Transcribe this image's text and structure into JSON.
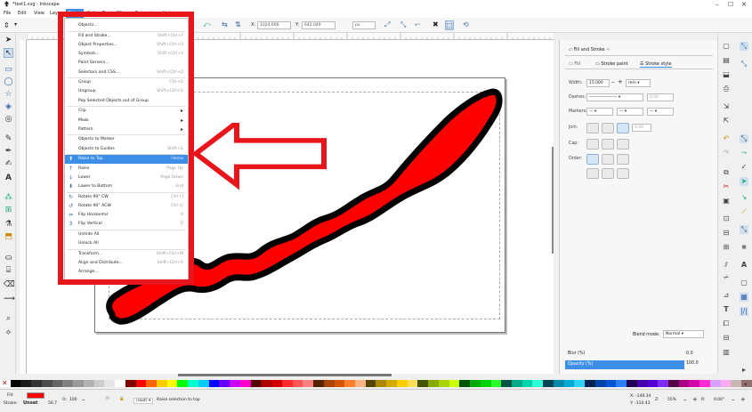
{
  "window": {
    "title": "*test1.svg - Inkscape",
    "controls": [
      "–",
      "☐",
      "✕"
    ]
  },
  "menubar": {
    "items": [
      "File",
      "Edit",
      "View",
      "Layer",
      "Object",
      "Path",
      "Text",
      "Filters",
      "Extensions",
      "Help"
    ],
    "active": "Object"
  },
  "ctrlbar": {
    "x_label": "X:",
    "x_value": "1024.606",
    "y_label": "Y:",
    "y_value": "642.049",
    "unit": "px"
  },
  "object_menu": {
    "items": [
      {
        "label": "Objects...",
        "shortcut": ""
      },
      {
        "label": "Fill and Stroke...",
        "shortcut": "Shift+Ctrl+F"
      },
      {
        "label": "Object Properties...",
        "shortcut": "Shift+Ctrl+O"
      },
      {
        "label": "Symbols...",
        "shortcut": "Shift+Ctrl+Y"
      },
      {
        "label": "Paint Servers...",
        "shortcut": ""
      },
      {
        "label": "Selectors and CSS...",
        "shortcut": "Shift+Ctrl+Q"
      },
      {
        "label": "Group",
        "shortcut": "Ctrl+G"
      },
      {
        "label": "Ungroup",
        "shortcut": "Shift+Ctrl+G"
      },
      {
        "label": "Pop Selected Objects out of Group",
        "shortcut": ""
      },
      {
        "label": "Clip",
        "shortcut": "",
        "submenu": true
      },
      {
        "label": "Mask",
        "shortcut": "",
        "submenu": true
      },
      {
        "label": "Pattern",
        "shortcut": "",
        "submenu": true
      },
      {
        "label": "Objects to Marker",
        "shortcut": ""
      },
      {
        "label": "Objects to Guides",
        "shortcut": "Shift+G"
      },
      {
        "label": "Raise to Top",
        "shortcut": "Home",
        "highlighted": true
      },
      {
        "label": "Raise",
        "shortcut": "Page Up"
      },
      {
        "label": "Lower",
        "shortcut": "Page Down"
      },
      {
        "label": "Lower to Bottom",
        "shortcut": "End"
      },
      {
        "label": "Rotate 90° CW",
        "shortcut": "Ctrl+]"
      },
      {
        "label": "Rotate 90° ACW",
        "shortcut": "Ctrl+["
      },
      {
        "label": "Flip Horizontal",
        "shortcut": "H"
      },
      {
        "label": "Flip Vertical",
        "shortcut": "V"
      },
      {
        "label": "Unhide All",
        "shortcut": ""
      },
      {
        "label": "Unlock All",
        "shortcut": ""
      },
      {
        "label": "Transform...",
        "shortcut": "Shift+Ctrl+M"
      },
      {
        "label": "Align and Distribute...",
        "shortcut": "Shift+Ctrl+A"
      },
      {
        "label": "Arrange...",
        "shortcut": ""
      }
    ]
  },
  "dock": {
    "panel_title": "Fill and Stroke",
    "tabs": [
      "Fill",
      "Stroke paint",
      "Stroke style"
    ],
    "width_label": "Width:",
    "width_value": "15.000",
    "width_unit": "mm",
    "dashes_label": "Dashes:",
    "dashes_value": "0.00",
    "markers_label": "Markers:",
    "join_label": "Join:",
    "join_value": "4.00",
    "cap_label": "Cap:",
    "order_label": "Order:",
    "blend_label": "Blend mode:",
    "blend_value": "Normal",
    "blur_label": "Blur (%)",
    "blur_value": "0.0",
    "opacity_label": "Opacity (%)",
    "opacity_value": "100.0"
  },
  "statusbar": {
    "fill_label": "Fill:",
    "stroke_label": "Stroke:",
    "stroke_state": "Unset",
    "stroke_width": "56.7",
    "opacity_label": "O:",
    "opacity_value": "100",
    "layer": "(root)",
    "message": "Raise selection to top",
    "x_coord": "X: -149.34",
    "y_coord": "Y: -110.43",
    "zoom_label": "Z:",
    "zoom": "55%",
    "rotation_label": "R:",
    "rotation": "0.00°"
  },
  "colors": {
    "shape_fill": "#ff0000",
    "shape_stroke": "#000000",
    "annotation": "#e8151b",
    "highlight": "#3d8ee6"
  }
}
